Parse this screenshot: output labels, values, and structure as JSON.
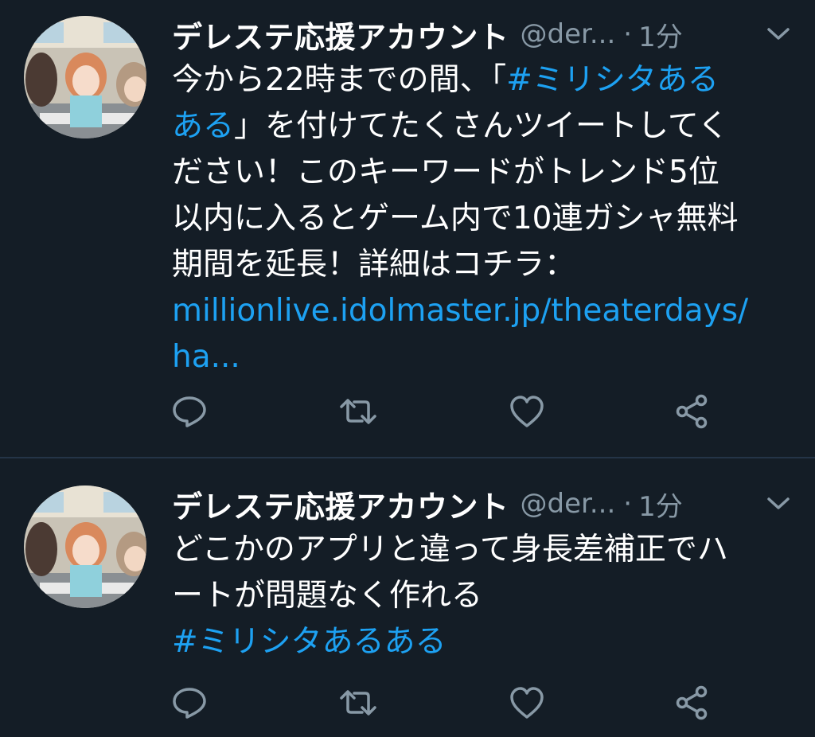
{
  "colors": {
    "background": "#141d26",
    "text": "#ffffff",
    "secondary": "#8899a6",
    "link": "#1da1f2",
    "divider": "#243447"
  },
  "tweets": [
    {
      "display_name": "デレステ応援アカウント",
      "handle": "@der...",
      "separator": "·",
      "time": "1分",
      "lines": [
        {
          "pre": "今から22時までの間、「",
          "link": "#ミリシタある",
          "post": ""
        },
        {
          "pre": "",
          "link": "ある",
          "post": "」を付けてたくさんツイートしてく"
        },
        {
          "pre": "ださい！このキーワードがトレンド5位",
          "link": "",
          "post": ""
        },
        {
          "pre": "以内に入るとゲーム内で10連ガシャ無料",
          "link": "",
          "post": ""
        },
        {
          "pre": "期間を延長！詳細はコチラ：",
          "link": "",
          "post": ""
        },
        {
          "pre": "",
          "link": "millionlive.idolmaster.jp/theaterdays/",
          "post": ""
        },
        {
          "pre": "",
          "link": "ha...",
          "post": ""
        }
      ],
      "actions": {
        "reply_icon": "reply-icon",
        "retweet_icon": "retweet-icon",
        "like_icon": "heart-icon",
        "share_icon": "share-icon"
      }
    },
    {
      "display_name": "デレステ応援アカウント",
      "handle": "@der...",
      "separator": "·",
      "time": "1分",
      "lines": [
        {
          "pre": "どこかのアプリと違って身長差補正でハ",
          "link": "",
          "post": ""
        },
        {
          "pre": "ートが問題なく作れる",
          "link": "",
          "post": ""
        },
        {
          "pre": "",
          "link": "#ミリシタあるある",
          "post": ""
        }
      ],
      "actions": {
        "reply_icon": "reply-icon",
        "retweet_icon": "retweet-icon",
        "like_icon": "heart-icon",
        "share_icon": "share-icon"
      }
    }
  ]
}
